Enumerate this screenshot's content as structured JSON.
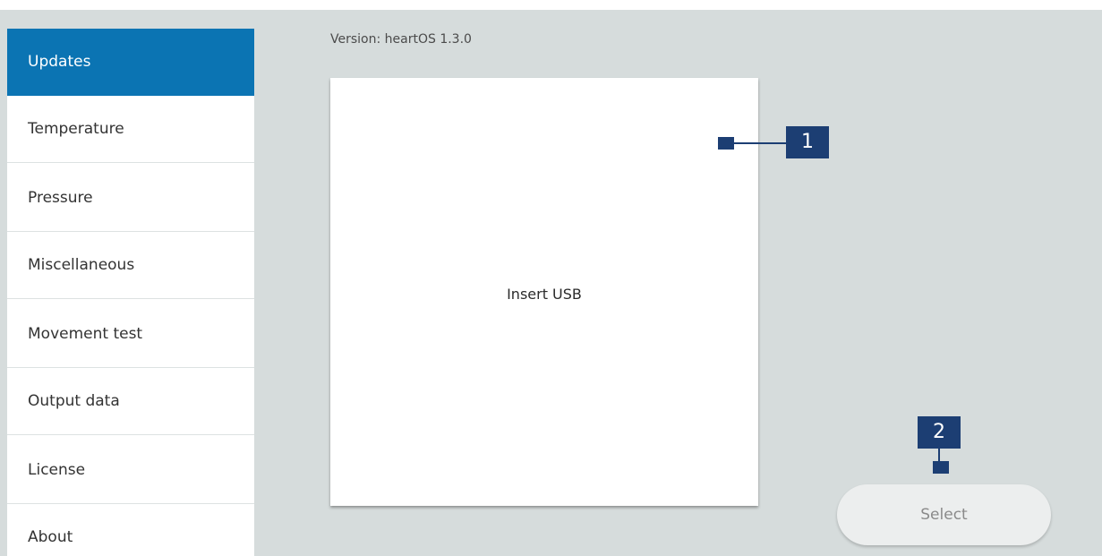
{
  "sidebar": {
    "items": [
      {
        "label": "Updates"
      },
      {
        "label": "Temperature"
      },
      {
        "label": "Pressure"
      },
      {
        "label": "Miscellaneous"
      },
      {
        "label": "Movement test"
      },
      {
        "label": "Output data"
      },
      {
        "label": "License"
      },
      {
        "label": "About"
      }
    ],
    "active": "Updates"
  },
  "main": {
    "version": "Version: heartOS 1.3.0",
    "panel_message": "Insert USB",
    "select_label": "Select"
  },
  "callouts": {
    "one": "1",
    "two": "2"
  },
  "colors": {
    "accent": "#0b74b3",
    "callout": "#1c3e73",
    "background": "#d6dcdc"
  }
}
